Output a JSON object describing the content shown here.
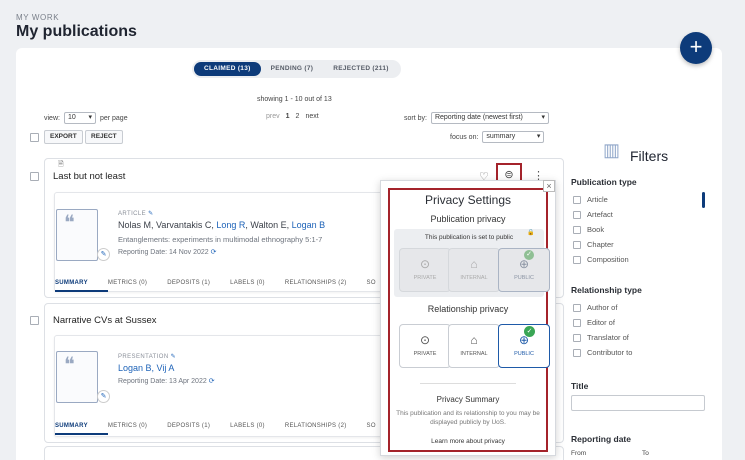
{
  "header": {
    "section": "MY WORK",
    "title": "My publications",
    "add": "+"
  },
  "tabs": [
    {
      "label": "CLAIMED (13)",
      "active": true
    },
    {
      "label": "PENDING (7)",
      "active": false
    },
    {
      "label": "REJECTED (211)",
      "active": false
    }
  ],
  "toolbar": {
    "showing": "showing 1 - 10 out of 13",
    "view_label": "view:",
    "view_value": "10",
    "per_page": "per page",
    "prev": "prev",
    "page1": "1",
    "page2": "2",
    "next": "next",
    "sort_label": "sort by:",
    "sort_value": "Reporting date (newest first)",
    "export": "EXPORT",
    "reject": "REJECT",
    "focus_label": "focus on:",
    "focus_value": "summary"
  },
  "publications": [
    {
      "title": "Last but not least",
      "type": "ARTICLE",
      "authors_plain": "Nolas M, Varvantakis C, ",
      "authors_links": [
        "Long R",
        "Logan B"
      ],
      "authors_sep": ", Walton E, ",
      "venue": "Entanglements: experiments in multimodal ethnography 5:1-7",
      "reporting": "Reporting Date: 14 Nov 2022",
      "subtabs": [
        "SUMMARY",
        "METRICS (0)",
        "DEPOSITS (1)",
        "LABELS (0)",
        "RELATIONSHIPS (2)",
        "SO"
      ]
    },
    {
      "title": "Narrative CVs at Sussex",
      "type": "PRESENTATION",
      "authors_links": [
        "Logan B, Vij A"
      ],
      "reporting": "Reporting Date: 13 Apr 2022",
      "subtabs": [
        "SUMMARY",
        "METRICS (0)",
        "DEPOSITS (1)",
        "LABELS (0)",
        "RELATIONSHIPS (2)",
        "SO"
      ]
    }
  ],
  "privacy": {
    "title": "Privacy Settings",
    "pub_heading": "Publication privacy",
    "pub_note": "This publication is set to public",
    "rel_heading": "Relationship privacy",
    "options": [
      "PRIVATE",
      "INTERNAL",
      "PUBLIC"
    ],
    "summary_heading": "Privacy Summary",
    "summary_text": "This publication and its relationship to you may be displayed publicly by UoS.",
    "learn_more": "Learn more about privacy",
    "close": "×"
  },
  "filters": {
    "title": "Filters",
    "pub_type_heading": "Publication type",
    "pub_types": [
      "Article",
      "Artefact",
      "Book",
      "Chapter",
      "Composition"
    ],
    "rel_type_heading": "Relationship type",
    "rel_types": [
      "Author of",
      "Editor of",
      "Translator of",
      "Contributor to"
    ],
    "title_heading": "Title",
    "reporting_heading": "Reporting date",
    "from": "From",
    "to": "To"
  },
  "colors": {
    "brand": "#0d3b7a",
    "highlight": "#a4232b",
    "public": "#3aa655"
  }
}
